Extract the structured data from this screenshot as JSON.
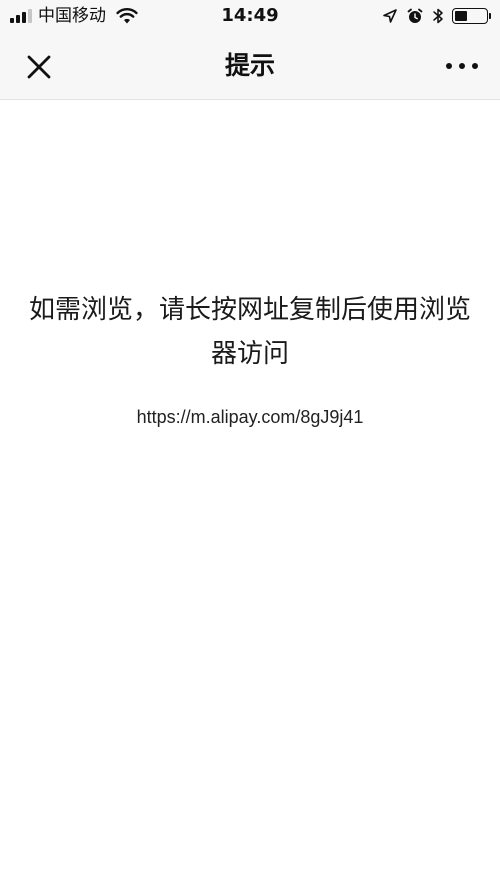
{
  "status_bar": {
    "carrier": "中国移动",
    "time": "14:49",
    "icons": [
      "signal-icon",
      "wifi-icon",
      "location-arrow-icon",
      "alarm-icon",
      "bluetooth-icon",
      "battery-icon"
    ],
    "battery_level": 0.4
  },
  "nav": {
    "title": "提示",
    "close_icon": "close-icon",
    "more_icon": "more-icon"
  },
  "main": {
    "message": "如需浏览，请长按网址复制后使用浏览器访问",
    "url": "https://m.alipay.com/8gJ9j41"
  },
  "colors": {
    "bar_background": "#f7f7f7",
    "page_background": "#ffffff",
    "text": "#111111"
  }
}
